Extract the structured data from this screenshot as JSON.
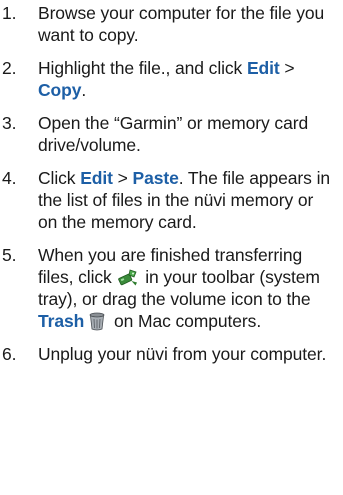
{
  "steps": [
    {
      "number": "1.",
      "text": "Browse your computer for the file you want to copy."
    },
    {
      "number": "2.",
      "text_before": "Highlight the file., and click ",
      "cmd1": "Edit",
      "sep": " > ",
      "cmd2": "Copy",
      "text_after": "."
    },
    {
      "number": "3.",
      "text": "Open the “Garmin” or memory card drive/volume."
    },
    {
      "number": "4.",
      "text_before": "Click ",
      "cmd1": "Edit",
      "sep": " > ",
      "cmd2": "Paste",
      "text_after": ". The file appears in the list of files in the nüvi memory or on the memory card."
    },
    {
      "number": "5.",
      "text_a": "When you are finished transferring files, click ",
      "icon_a": "safely-remove-hardware-icon",
      "text_b": " in your toolbar (system tray), or drag the volume icon to the ",
      "cmd": "Trash",
      "icon_b": "trash-can-icon",
      "text_c": " on Mac computers."
    },
    {
      "number": "6.",
      "text": "Unplug your nüvi from your computer."
    }
  ],
  "colors": {
    "command": "#1d5fa6",
    "text": "#1a1a1a"
  }
}
